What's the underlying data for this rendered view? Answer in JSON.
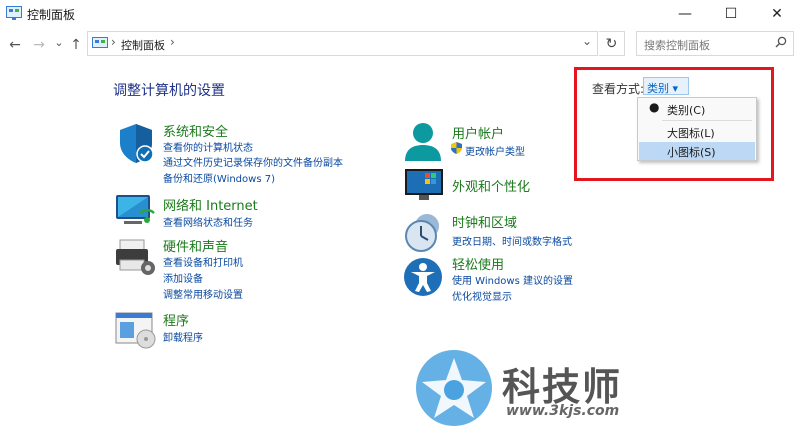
{
  "window": {
    "title": "控制面板",
    "minimize_glyph": "—",
    "maximize_glyph": "☐",
    "close_glyph": "✕"
  },
  "nav": {
    "back_glyph": "←",
    "forward_glyph": "→",
    "recent_glyph": "⌄",
    "up_glyph": "↑",
    "breadcrumb_sep1": "›",
    "breadcrumb_item": "控制面板",
    "breadcrumb_sep2": "›",
    "dropdown_glyph": "⌄",
    "refresh_glyph": "↻",
    "search_placeholder": "搜索控制面板"
  },
  "main": {
    "heading": "调整计算机的设置",
    "view_by_label": "查看方式:",
    "view_by_value": "类别 ▾",
    "view_menu": [
      {
        "label": "类别(C)",
        "selected_bullet": true,
        "highlighted": false
      },
      {
        "label": "大图标(L)",
        "selected_bullet": false,
        "highlighted": false
      },
      {
        "label": "小图标(S)",
        "selected_bullet": false,
        "highlighted": true
      }
    ]
  },
  "categories_left": [
    {
      "title": "系统和安全",
      "links": [
        "查看你的计算机状态",
        "通过文件历史记录保存你的文件备份副本",
        "备份和还原(Windows 7)"
      ],
      "icon": "shield-icon"
    },
    {
      "title": "网络和 Internet",
      "links": [
        "查看网络状态和任务"
      ],
      "icon": "network-icon"
    },
    {
      "title": "硬件和声音",
      "links": [
        "查看设备和打印机",
        "添加设备",
        "调整常用移动设置"
      ],
      "icon": "printer-icon"
    },
    {
      "title": "程序",
      "links": [
        "卸载程序"
      ],
      "icon": "programs-icon"
    }
  ],
  "categories_right": [
    {
      "title": "用户帐户",
      "links": [
        "更改帐户类型"
      ],
      "icon": "user-icon"
    },
    {
      "title": "外观和个性化",
      "links": [],
      "icon": "monitor-icon"
    },
    {
      "title": "时钟和区域",
      "links": [
        "更改日期、时间或数字格式"
      ],
      "icon": "clock-icon"
    },
    {
      "title": "轻松使用",
      "links": [
        "使用 Windows 建议的设置",
        "优化视觉显示"
      ],
      "icon": "accessibility-icon"
    }
  ],
  "watermark": {
    "text": "科技师",
    "url": "www.3kjs.com"
  },
  "colors": {
    "accent_red_frame": "#e3161f",
    "category_green": "#1b7a1b",
    "link_blue": "#0a4aa0",
    "heading_blue": "#1e3287",
    "menu_highlight": "#bcd8f4"
  }
}
